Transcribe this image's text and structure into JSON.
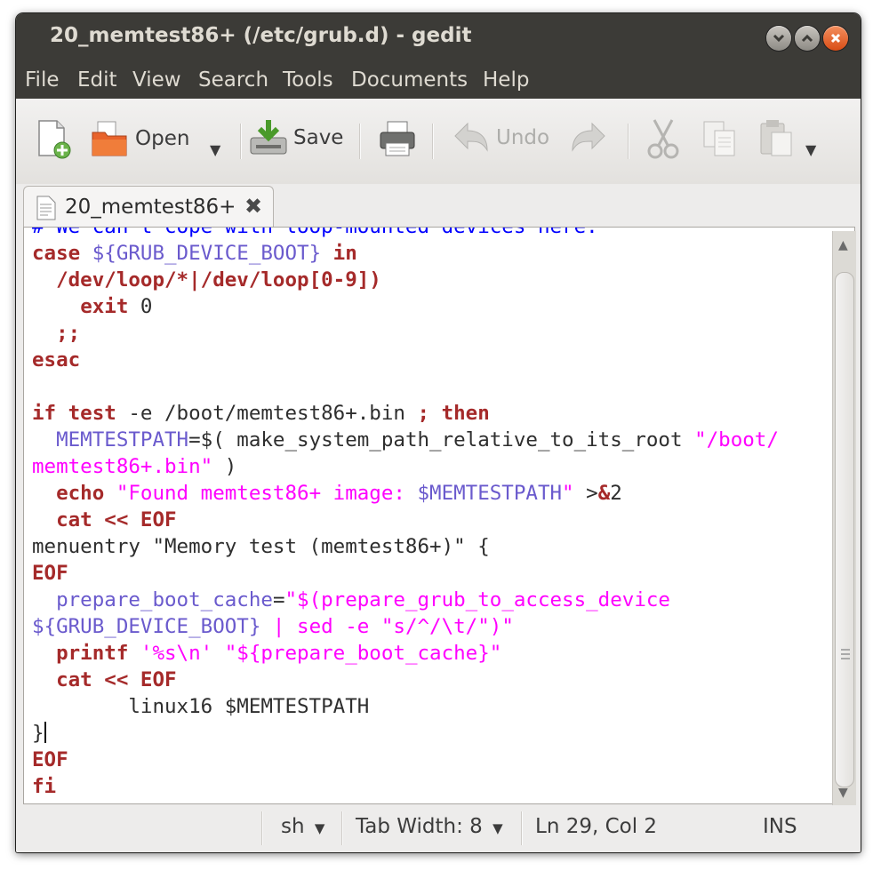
{
  "window": {
    "title": "20_memtest86+ (/etc/grub.d) - gedit",
    "controls": [
      "minimize",
      "maximize",
      "close"
    ]
  },
  "menu": [
    "File",
    "Edit",
    "View",
    "Search",
    "Tools",
    "Documents",
    "Help"
  ],
  "toolbar": {
    "new_icon": "new-document-icon",
    "open_label": "Open",
    "save_label": "Save",
    "print_icon": "print-icon",
    "undo_label": "Undo",
    "redo_icon": "redo-icon",
    "cut_icon": "cut-icon",
    "copy_icon": "copy-icon",
    "paste_icon": "paste-icon"
  },
  "tab": {
    "label": "20_memtest86+"
  },
  "code_lines": [
    [
      {
        "t": "# We can't cope with loop-mounted devices here.",
        "c": "cmt"
      }
    ],
    [
      {
        "t": "case",
        "c": "kw"
      },
      {
        "t": " "
      },
      {
        "t": "${GRUB_DEVICE_BOOT}",
        "c": "var"
      },
      {
        "t": " "
      },
      {
        "t": "in",
        "c": "kw"
      }
    ],
    [
      {
        "t": "  "
      },
      {
        "t": "/dev/loop/*|/dev/loop[0-9])",
        "c": "kw"
      }
    ],
    [
      {
        "t": "    "
      },
      {
        "t": "exit",
        "c": "kw"
      },
      {
        "t": " 0"
      }
    ],
    [
      {
        "t": "  "
      },
      {
        "t": ";;",
        "c": "kw"
      }
    ],
    [
      {
        "t": "esac",
        "c": "kw"
      }
    ],
    [],
    [
      {
        "t": "if",
        "c": "kw"
      },
      {
        "t": " "
      },
      {
        "t": "test",
        "c": "kw"
      },
      {
        "t": " -e /boot/memtest86+.bin "
      },
      {
        "t": ";",
        "c": "kw"
      },
      {
        "t": " "
      },
      {
        "t": "then",
        "c": "kw"
      }
    ],
    [
      {
        "t": "  "
      },
      {
        "t": "MEMTESTPATH",
        "c": "var"
      },
      {
        "t": "=$( make_system_path_relative_to_its_root "
      },
      {
        "t": "\"/boot/",
        "c": "str"
      }
    ],
    [
      {
        "t": "memtest86+.bin\"",
        "c": "str"
      },
      {
        "t": " )"
      }
    ],
    [
      {
        "t": "  "
      },
      {
        "t": "echo",
        "c": "kw"
      },
      {
        "t": " "
      },
      {
        "t": "\"Found memtest86+ image: ",
        "c": "str"
      },
      {
        "t": "$MEMTESTPATH",
        "c": "var"
      },
      {
        "t": "\"",
        "c": "str"
      },
      {
        "t": " >"
      },
      {
        "t": "&",
        "c": "kw"
      },
      {
        "t": "2"
      }
    ],
    [
      {
        "t": "  "
      },
      {
        "t": "cat",
        "c": "kw"
      },
      {
        "t": " "
      },
      {
        "t": "<< EOF",
        "c": "kw"
      }
    ],
    [
      {
        "t": "menuentry \"Memory test (memtest86+)\" {"
      }
    ],
    [
      {
        "t": "EOF",
        "c": "kw"
      }
    ],
    [
      {
        "t": "  "
      },
      {
        "t": "prepare_boot_cache",
        "c": "var"
      },
      {
        "t": "="
      },
      {
        "t": "\"$(prepare_grub_to_access_device",
        "c": "str"
      }
    ],
    [
      {
        "t": "${GRUB_DEVICE_BOOT}",
        "c": "var"
      },
      {
        "t": " | sed -e ",
        "c": "str"
      },
      {
        "t": "\"s/^/\\t/\"",
        "c": "str"
      },
      {
        "t": ")\"",
        "c": "str"
      }
    ],
    [
      {
        "t": "  "
      },
      {
        "t": "printf",
        "c": "kw"
      },
      {
        "t": " "
      },
      {
        "t": "'%s\\n'",
        "c": "str"
      },
      {
        "t": " "
      },
      {
        "t": "\"${prepare_boot_cache}\"",
        "c": "str"
      }
    ],
    [
      {
        "t": "  "
      },
      {
        "t": "cat",
        "c": "kw"
      },
      {
        "t": " "
      },
      {
        "t": "<< EOF",
        "c": "kw"
      }
    ],
    [
      {
        "t": "        linux16 $MEMTESTPATH"
      }
    ],
    [
      {
        "t": "}"
      },
      {
        "cursor": true
      }
    ],
    [
      {
        "t": "EOF",
        "c": "kw"
      }
    ],
    [
      {
        "t": "fi",
        "c": "kw"
      }
    ]
  ],
  "status": {
    "language": "sh",
    "tab_width": "Tab Width:  8",
    "position": "Ln 29, Col 2",
    "mode": "INS"
  }
}
